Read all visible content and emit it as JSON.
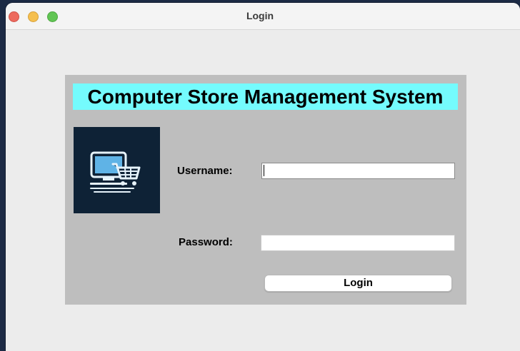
{
  "window": {
    "title": "Login"
  },
  "banner": {
    "text": "Computer Store Management System"
  },
  "logo": {
    "icon": "computer-cart-icon"
  },
  "form": {
    "username_label": "Username:",
    "username_value": "",
    "password_label": "Password:",
    "password_value": "",
    "login_label": "Login"
  },
  "colors": {
    "banner_bg": "#74fbfd",
    "panel_bg": "#bebebe",
    "logo_bg": "#0e2236"
  }
}
